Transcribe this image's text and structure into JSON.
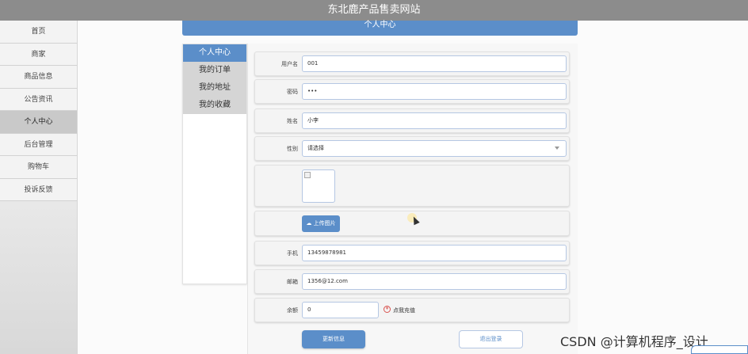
{
  "site": {
    "title": "东北鹿产品售卖网站"
  },
  "nav": {
    "items": [
      {
        "label": "首页"
      },
      {
        "label": "商家"
      },
      {
        "label": "商品信息"
      },
      {
        "label": "公告资讯"
      },
      {
        "label": "个人中心",
        "active": true
      },
      {
        "label": "后台管理"
      },
      {
        "label": "购物车"
      },
      {
        "label": "投诉反馈"
      }
    ]
  },
  "section": {
    "title": "个人中心"
  },
  "submenu": {
    "items": [
      {
        "label": "个人中心",
        "active": true
      },
      {
        "label": "我的订单"
      },
      {
        "label": "我的地址"
      },
      {
        "label": "我的收藏"
      }
    ]
  },
  "form": {
    "username": {
      "label": "用户名",
      "value": "001"
    },
    "password": {
      "label": "密码",
      "value": "•••"
    },
    "name": {
      "label": "姓名",
      "value": "小李"
    },
    "gender": {
      "label": "性别",
      "value": "请选择"
    },
    "upload": {
      "label": "上传图片"
    },
    "phone": {
      "label": "手机",
      "value": "13459878981"
    },
    "email": {
      "label": "邮箱",
      "value": "1356@12.com"
    },
    "balance": {
      "label": "余额",
      "value": "0",
      "recharge_label": "点我充值"
    },
    "update_label": "更新信息",
    "logout_label": "退出登录"
  },
  "watermark": "CSDN @计算机程序_设计",
  "colors": {
    "accent": "#5b8ec9",
    "topbar": "#8c8c8c"
  },
  "icons": {
    "upload": "cloud-upload-icon",
    "recharge": "yen-circle-icon"
  }
}
